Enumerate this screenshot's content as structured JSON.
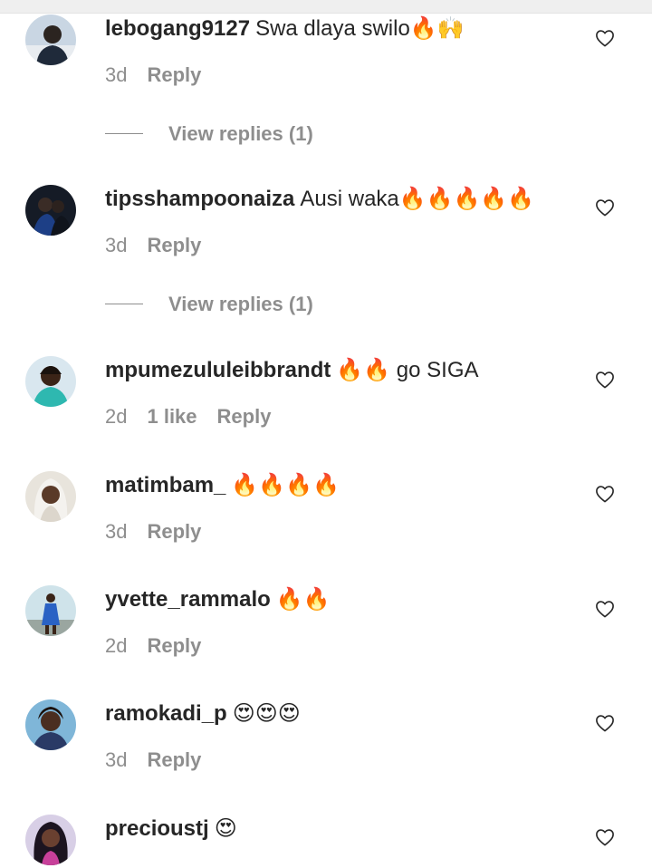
{
  "comments": [
    {
      "username": "lebogang9127",
      "text": "Swa dlaya swilo🔥🙌",
      "time": "3d",
      "likes": "",
      "reply": "Reply",
      "view_replies": "View replies (1)"
    },
    {
      "username": "tipsshampoonaiza",
      "text": "Ausi waka🔥🔥🔥🔥🔥",
      "time": "3d",
      "likes": "",
      "reply": "Reply",
      "view_replies": "View replies (1)"
    },
    {
      "username": "mpumezululeibbrandt",
      "text": "🔥🔥 go SIGA",
      "time": "2d",
      "likes": "1 like",
      "reply": "Reply",
      "view_replies": ""
    },
    {
      "username": "matimbam_",
      "text": "🔥🔥🔥🔥",
      "time": "3d",
      "likes": "",
      "reply": "Reply",
      "view_replies": ""
    },
    {
      "username": "yvette_rammalo",
      "text": "🔥🔥",
      "time": "2d",
      "likes": "",
      "reply": "Reply",
      "view_replies": ""
    },
    {
      "username": "ramokadi_p",
      "text": "😍😍😍",
      "time": "3d",
      "likes": "",
      "reply": "Reply",
      "view_replies": ""
    },
    {
      "username": "precioustj",
      "text": "😍",
      "time": "",
      "likes": "",
      "reply": "",
      "view_replies": ""
    }
  ],
  "icons": {
    "like": "heart-outline-icon"
  },
  "colors": {
    "text": "#262626",
    "secondary": "#8e8e8e"
  }
}
